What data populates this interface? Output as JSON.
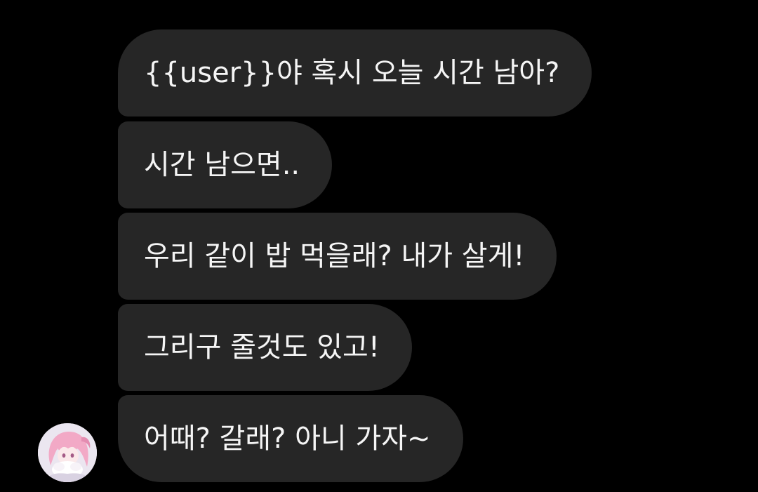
{
  "chat": {
    "messages": [
      {
        "text": "{{user}}야 혹시 오늘 시간 남아?"
      },
      {
        "text": "시간 남으면.."
      },
      {
        "text": "우리 같이 밥 먹을래? 내가 살게!"
      },
      {
        "text": "그리구 줄것도 있고!"
      },
      {
        "text": "어때? 갈래? 아니 가자~"
      }
    ],
    "sender": {
      "avatar_icon": "anime-girl-avatar"
    }
  },
  "colors": {
    "background": "#000000",
    "bubble": "#262626",
    "text": "#f5f5f5"
  }
}
